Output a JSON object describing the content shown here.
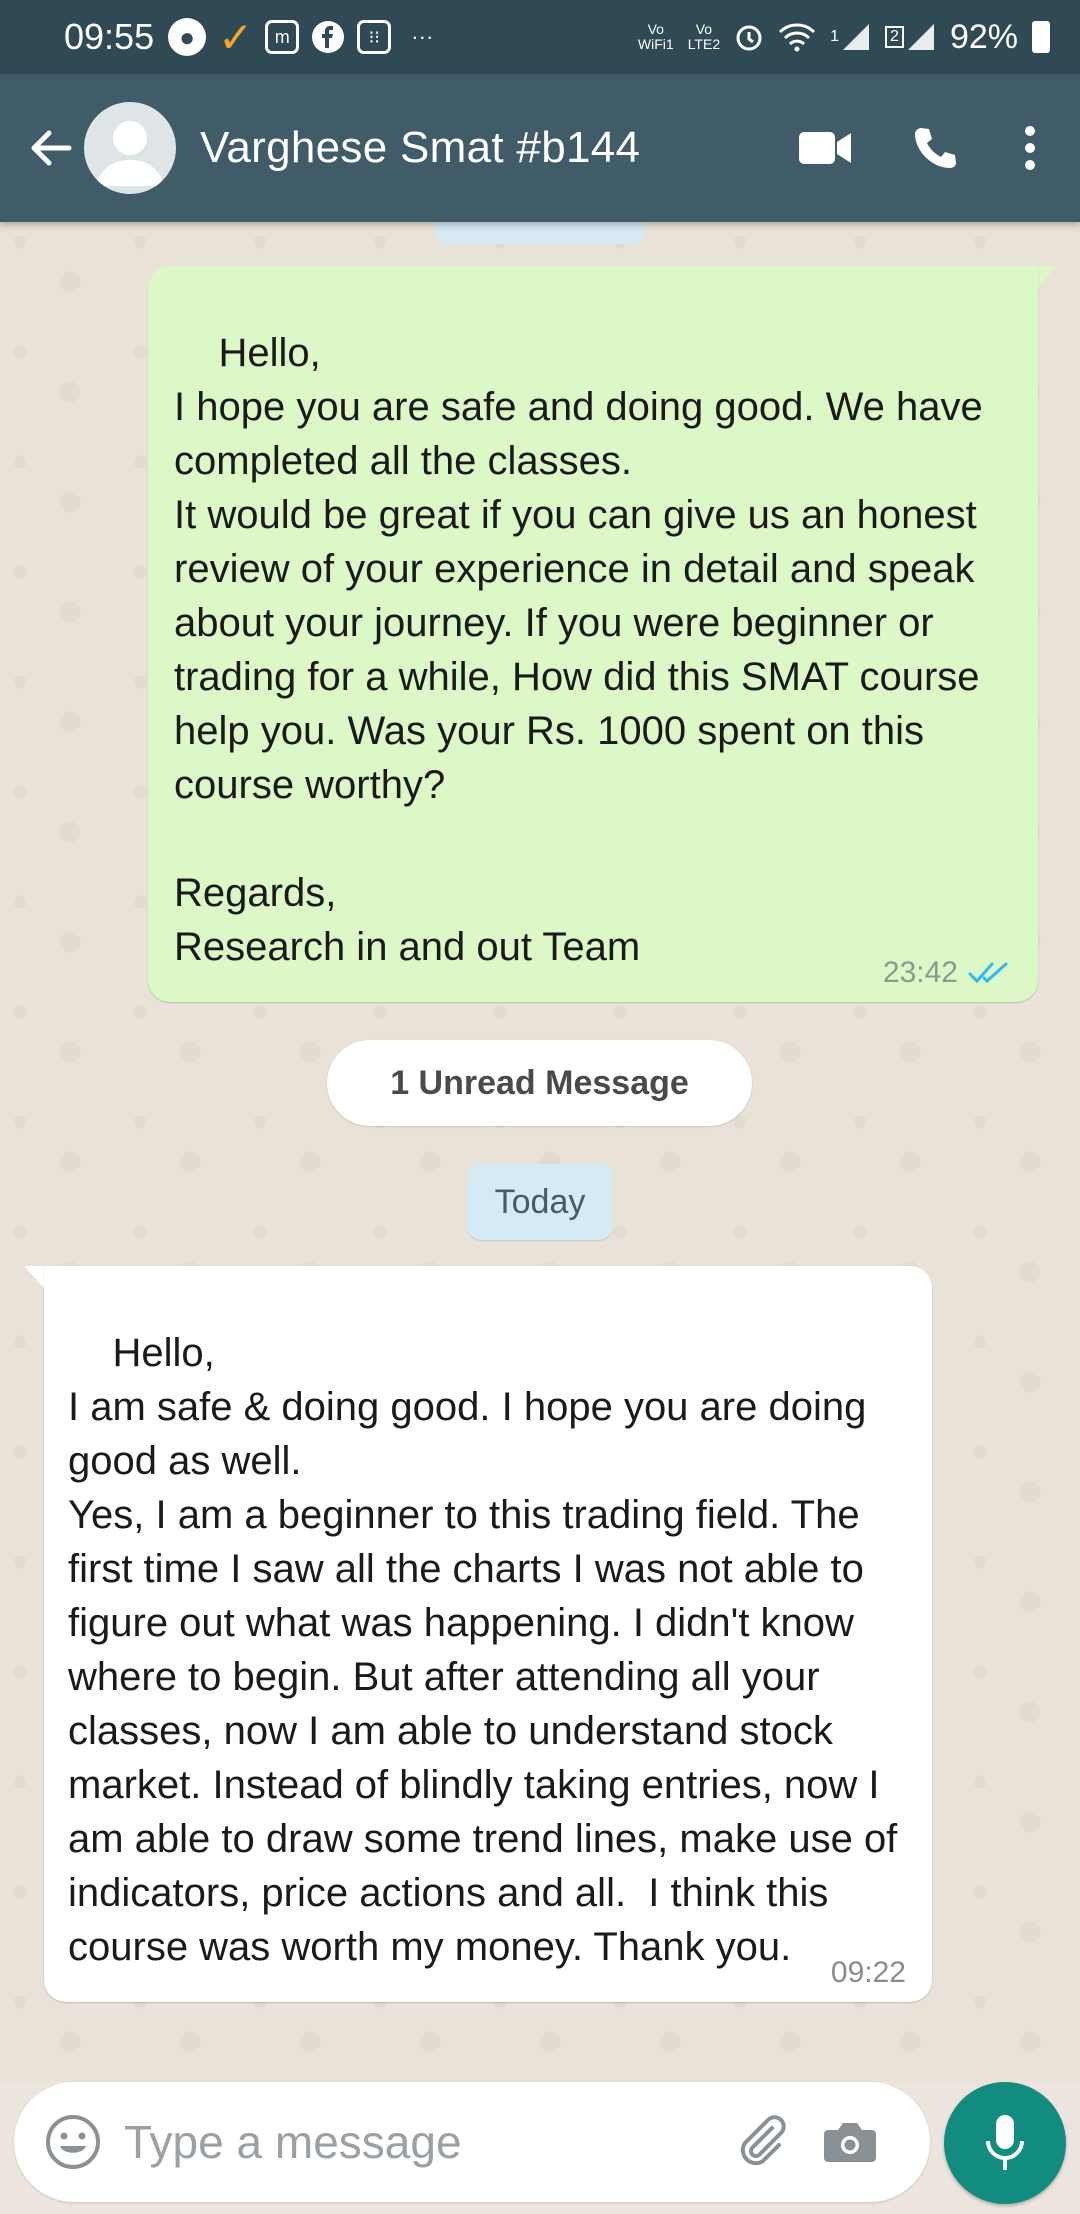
{
  "status_bar": {
    "time": "09:55",
    "vowifi": "Vo\nWiFi1",
    "volte": "Vo\nLTE2",
    "sim1": "1",
    "sim2": "2",
    "battery": "92%"
  },
  "header": {
    "contact_name": "Varghese Smat #b144"
  },
  "messages": [
    {
      "direction": "outgoing",
      "text": "Hello,\nI hope you are safe and doing good. We have completed all the classes.\nIt would be great if you can give us an honest review of your experience in detail and speak about your journey. If you were beginner or trading for a while, How did this SMAT course help you. Was your Rs. 1000 spent on this course worthy?\n\nRegards,\nResearch in and out Team",
      "time": "23:42",
      "status": "read"
    },
    {
      "direction": "incoming",
      "text": "Hello,\nI am safe & doing good. I hope you are doing good as well.\nYes, I am a beginner to this trading field. The first time I saw all the charts I was not able to  figure out what was happening. I didn't know where to begin. But after attending all your classes, now I am able to understand stock market. Instead of blindly taking entries, now I am able to draw some trend lines, make use of indicators, price actions and all.  I think this course was worth my money. Thank you.",
      "time": "09:22"
    }
  ],
  "unread_banner": "1 Unread Message",
  "date_separator": "Today",
  "input": {
    "placeholder": "Type a message"
  },
  "colors": {
    "header": "#3f5c68",
    "status_bar": "#304a55",
    "outgoing_bubble": "#dcf8c6",
    "incoming_bubble": "#ffffff",
    "accent": "#128c7e",
    "read_ticks": "#34b7f1"
  },
  "icons": [
    "back-arrow-icon",
    "avatar-icon",
    "video-call-icon",
    "phone-icon",
    "more-vertical-icon",
    "emoji-icon",
    "attach-icon",
    "camera-icon",
    "mic-icon",
    "double-check-icon"
  ]
}
